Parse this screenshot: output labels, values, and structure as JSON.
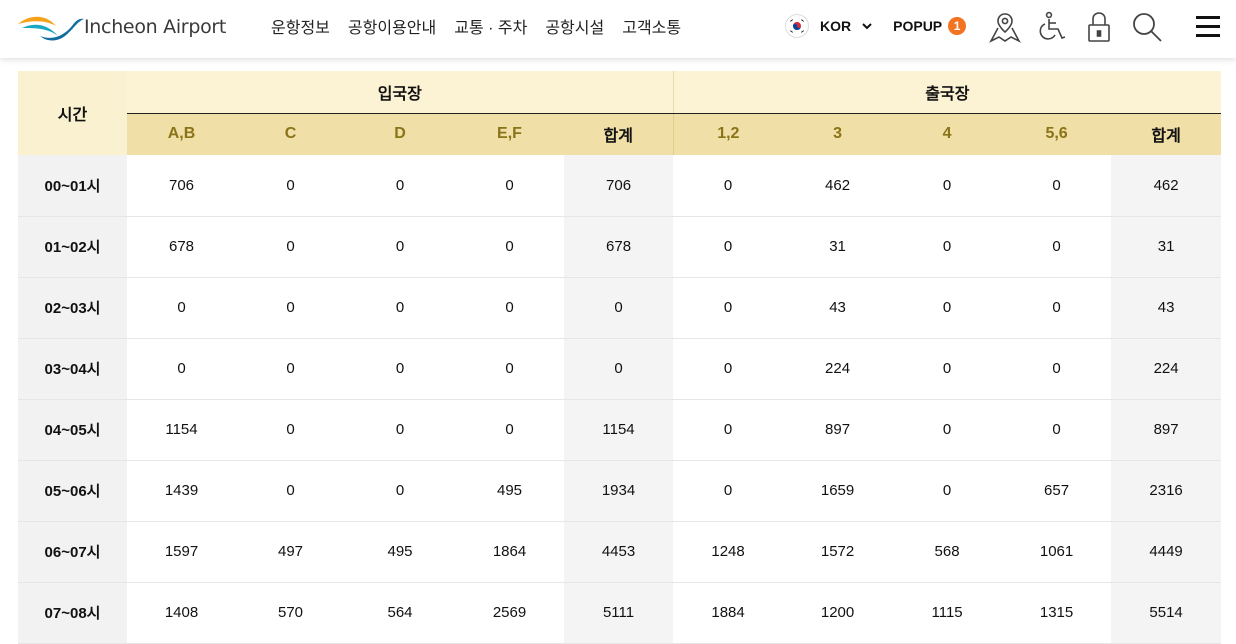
{
  "header": {
    "logo_text": "Incheon Airport",
    "nav": [
      "운항정보",
      "공항이용안내",
      "교통 · 주차",
      "공항시설",
      "고객소통"
    ],
    "lang": "KOR",
    "popup_label": "POPUP",
    "popup_count": "1",
    "icons": [
      "map-icon",
      "accessibility-icon",
      "locker-icon",
      "search-icon",
      "menu-icon"
    ]
  },
  "colors": {
    "accent_orange": "#f37321",
    "header_light": "#fbf3d4",
    "header_dark": "#f0dfa6",
    "gold_text": "#8a7418"
  },
  "table": {
    "time_header": "시간",
    "groups": [
      "입국장",
      "출국장"
    ],
    "sub_headers": [
      "A,B",
      "C",
      "D",
      "E,F",
      "합계",
      "1,2",
      "3",
      "4",
      "5,6",
      "합계"
    ],
    "rows": [
      {
        "time": "00~01시",
        "values": [
          "706",
          "0",
          "0",
          "0",
          "706",
          "0",
          "462",
          "0",
          "0",
          "462"
        ]
      },
      {
        "time": "01~02시",
        "values": [
          "678",
          "0",
          "0",
          "0",
          "678",
          "0",
          "31",
          "0",
          "0",
          "31"
        ]
      },
      {
        "time": "02~03시",
        "values": [
          "0",
          "0",
          "0",
          "0",
          "0",
          "0",
          "43",
          "0",
          "0",
          "43"
        ]
      },
      {
        "time": "03~04시",
        "values": [
          "0",
          "0",
          "0",
          "0",
          "0",
          "0",
          "224",
          "0",
          "0",
          "224"
        ]
      },
      {
        "time": "04~05시",
        "values": [
          "1154",
          "0",
          "0",
          "0",
          "1154",
          "0",
          "897",
          "0",
          "0",
          "897"
        ]
      },
      {
        "time": "05~06시",
        "values": [
          "1439",
          "0",
          "0",
          "495",
          "1934",
          "0",
          "1659",
          "0",
          "657",
          "2316"
        ]
      },
      {
        "time": "06~07시",
        "values": [
          "1597",
          "497",
          "495",
          "1864",
          "4453",
          "1248",
          "1572",
          "568",
          "1061",
          "4449"
        ]
      },
      {
        "time": "07~08시",
        "values": [
          "1408",
          "570",
          "564",
          "2569",
          "5111",
          "1884",
          "1200",
          "1115",
          "1315",
          "5514"
        ]
      }
    ]
  }
}
